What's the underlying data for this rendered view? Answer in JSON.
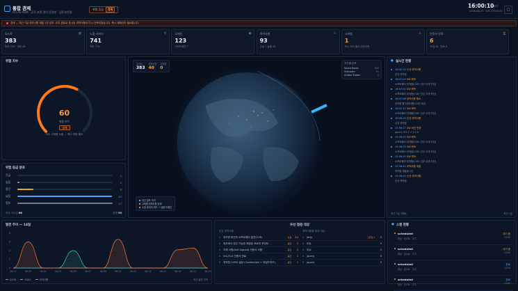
{
  "header": {
    "title": "통합 관제",
    "subtitle": "ATLAS-ASM · 공격 표면 관리 운영판 · 검토부연결",
    "risk_label": "위험 등급",
    "risk_value": "경계",
    "time": "16:00:10",
    "tz": "KST",
    "date": "2026-06-23 · UTC 07:00:10",
    "menu_icon": "□"
  },
  "alert": {
    "text": "경계 — 최근 7일 취약사항 재발 1건 감지. 조치 완료로 표시된 취약사항이 다시 관측되었습니다. 즉시 재확인이 필요합니다."
  },
  "cards": [
    {
      "label": "호스트",
      "value": "383",
      "sub": "외부 335 · 내부 48",
      "icon": "▥"
    },
    {
      "label": "노출 서비스",
      "value": "741",
      "sub": "포트 774",
      "icon": "⚲"
    },
    {
      "label": "도메인",
      "value": "123",
      "sub": "서브도메인 7",
      "icon": "◉"
    },
    {
      "label": "취약사항",
      "value": "93",
      "sub": "긴급 7 높음 45",
      "icon": "⚠"
    },
    {
      "label": "고위험",
      "value": "1",
      "sub": "즉시 조치 필요 취약사항",
      "icon": "⚠",
      "orange": true
    },
    {
      "label": "인증서 만료",
      "value": "6",
      "sub": "30일 내 · 만료 0",
      "icon": "⚿",
      "orange": true
    }
  ],
  "gauge": {
    "title": "위험 지수",
    "value": "60",
    "label": "위험 지수",
    "status": "경계",
    "desc": "다수 고위험 노출 — 즉시 대응 필요",
    "fraction": 0.6
  },
  "dist": {
    "title": "위험 등급 분포",
    "rows": [
      {
        "label": "긴급",
        "count": "0",
        "frac": 0.0,
        "color": "#e5484d"
      },
      {
        "label": "높음",
        "count": "1",
        "frac": 0.02,
        "color": "#ff7a3d"
      },
      {
        "label": "중간",
        "count": "3",
        "frac": 0.17,
        "color": "#f5a524"
      },
      {
        "label": "낮음",
        "count": "42",
        "frac": 0.99,
        "color": "#4ea3ff"
      },
      {
        "label": "정보",
        "count": "47",
        "frac": 1.0,
        "color": "#6b7c96"
      }
    ],
    "foot_left": "자산 가시성",
    "foot_left_val": "66",
    "foot_right": "전체",
    "foot_right_val": "93"
  },
  "globe": {
    "stats": [
      {
        "label": "호스트",
        "value": "383"
      },
      {
        "label": "취약사항",
        "value": "40",
        "orange": true
      },
      {
        "label": "고위험",
        "value": "0",
        "orange": true
      }
    ],
    "legend_title": "국가별 분포",
    "legend": [
      {
        "name": "South Korea",
        "count": "340"
      },
      {
        "name": "Unknown",
        "count": "41"
      },
      {
        "name": "United States",
        "count": "2"
      }
    ],
    "key": [
      "자산 분포 국가",
      "고위험 취약사항 존재",
      "수집 데이터 피드 → 검증 도메인"
    ]
  },
  "feed": {
    "title": "실시간 현황",
    "items": [
      {
        "t": "16:00:15",
        "tag": "신규 취약사항",
        "d": "신규 취약점"
      },
      {
        "t": "16:07:00",
        "tag": "SW 획득",
        "d": "소프트웨어 취약점(CVE) 신규 (3개 자산)"
      },
      {
        "t": "16:07:02",
        "tag": "SW 획득",
        "d": "소프트웨어 취약점(CVE) 신규 (3개 자산)"
      },
      {
        "t": "16:07:08",
        "tag": "취약사항 해소",
        "d": "취약한 웹 취약사항(13개 자산)"
      },
      {
        "t": "16:07:11",
        "tag": "SW 획득",
        "d": "소프트웨어 취약점(CVE) 신규 (3개 자산)"
      },
      {
        "t": "16:06:15",
        "tag": "신규 취약사항",
        "d": "신규 취약점"
      },
      {
        "t": "15:56:17",
        "tag": "SW 버전 변경",
        "d": "jquery 3.5.1 → 3.7.0"
      },
      {
        "t": "15:56:22",
        "tag": "SW 획득",
        "d": "소프트웨어 취약점(CVE) 신규 (3개 자산)"
      },
      {
        "t": "15:56:25",
        "tag": "SW 획득",
        "d": "소프트웨어 취약점(CVE) 신규 (3개 자산)"
      },
      {
        "t": "15:56:30",
        "tag": "SW 획득",
        "d": "소프트웨어 취약점(CVE) 신규 (3개 자산)"
      },
      {
        "t": "15:56:40",
        "tag": "취약사항 재발",
        "d": "취약한 재발생 1건"
      },
      {
        "t": "15:56:45",
        "tag": "신규 취약사항",
        "d": "신규 취약점"
      }
    ],
    "foot_left": "최근 7일 이벤트",
    "foot_right": "최근 7일"
  },
  "trend": {
    "title": "발견 추이 — 14일",
    "legend": [
      "호스트",
      "서비스",
      "취약사항"
    ],
    "foot": "최근 발견 이력"
  },
  "chart_data": {
    "type": "line",
    "x": [
      "06-27",
      "06-29",
      "06-01",
      "06-03",
      "06-05",
      "06-07",
      "06-09",
      "06-11",
      "06-13",
      "06-15",
      "06-17",
      "06-19",
      "06-21",
      "06-23"
    ],
    "ylim": [
      0,
      4
    ],
    "yticks": [
      "0",
      "1",
      "2",
      "3",
      "4"
    ],
    "series": [
      {
        "name": "호스트",
        "values": [
          0,
          0,
          0,
          0,
          0,
          0,
          0,
          0,
          0,
          0,
          0,
          0,
          0,
          0
        ],
        "color": "#4ea3ff"
      },
      {
        "name": "서비스",
        "values": [
          0,
          0,
          0,
          0,
          2,
          0,
          0,
          0,
          0,
          0,
          0,
          0,
          0,
          0
        ],
        "color": "#3ec9c0"
      },
      {
        "name": "취약사항",
        "values": [
          0,
          3,
          0,
          0,
          0,
          0,
          0,
          3.3,
          0,
          0,
          0,
          2.1,
          2.3,
          0
        ],
        "color": "#ff7a3d"
      }
    ]
  },
  "targets": {
    "title": "우선 점검 대상",
    "left_title": "우선 취약사항",
    "left": [
      {
        "no": "1",
        "name": "취약한 버전의 소프트웨어 발견(CVE)",
        "sev": "높음",
        "cnt": "44"
      },
      {
        "no": "2",
        "name": "외부에서 접근 가능한 제한된 포트의 포인트",
        "sev": "중간",
        "cnt": "2"
      },
      {
        "no": "3",
        "name": "자체 서명(Self-Signed) 인증서 사용",
        "sev": "중간",
        "cnt": "2"
      },
      {
        "no": "4",
        "name": "SSL/TLS 인증서 만료",
        "sev": "중간",
        "cnt": "1"
      },
      {
        "no": "5",
        "name": "취약한 CORS 설정 (Credentials + 와일드카드)",
        "sev": "중간",
        "cnt": "1"
      }
    ],
    "right_title": "취약사항별 점검 대상",
    "right": [
      {
        "no": "1",
        "name": "jetty",
        "badge": "고위험 1",
        "cnt": "5"
      },
      {
        "no": "2",
        "name": "SQL",
        "cnt": "5"
      },
      {
        "no": "3",
        "name": "SQL",
        "cnt": "5"
      },
      {
        "no": "4",
        "name": "jquery",
        "cnt": "5"
      },
      {
        "no": "5",
        "name": "jquery",
        "cnt": "5"
      }
    ]
  },
  "schedule": {
    "title": "스캔 현황",
    "items": [
      {
        "n": "scheduled",
        "m": "대상 · 호스트 · 주기",
        "tag": "대기 중",
        "tag2": "14:00"
      },
      {
        "n": "scheduled",
        "m": "대상 · 호스트 · 주기",
        "tag": "대기 중",
        "tag2": "14:00"
      },
      {
        "n": "scheduled",
        "m": "대상 · 호스트 · 주기",
        "tag": "완료",
        "tag2": "14:00"
      },
      {
        "n": "scheduled",
        "m": "대상 · 호스트 · 주기",
        "tag": "완료",
        "tag2": "14:00"
      }
    ]
  }
}
